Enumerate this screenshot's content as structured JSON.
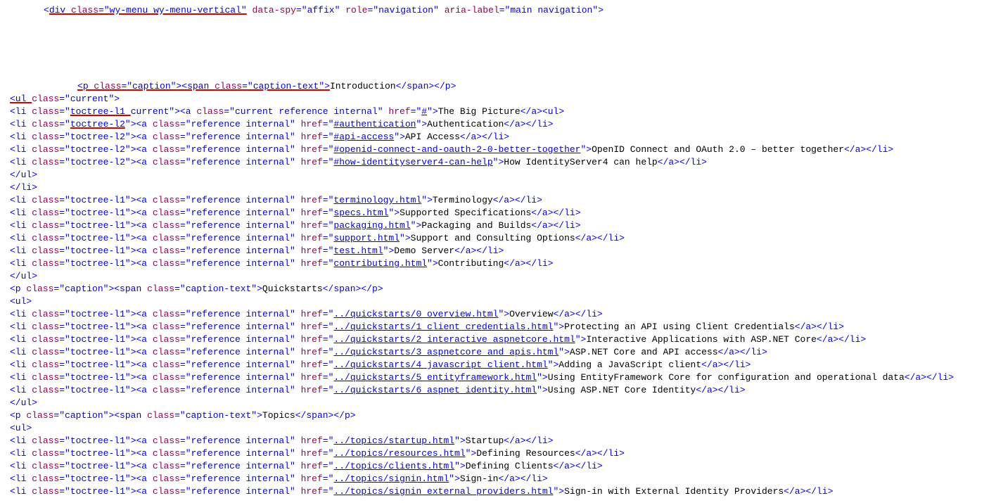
{
  "captions": {
    "intro": "Introduction",
    "quickstarts": "Quickstarts",
    "topics": "Topics"
  },
  "divAttrs": {
    "cls": "wy-menu wy-menu-vertical",
    "spy": "affix",
    "role": "navigation",
    "aria": "main navigation"
  },
  "introL1": [
    {
      "href": "#",
      "text": "The Big Picture",
      "current": true
    }
  ],
  "introL2": [
    {
      "href": "#authentication",
      "text": "Authentication"
    },
    {
      "href": "#api-access",
      "text": "API Access"
    },
    {
      "href": "#openid-connect-and-oauth-2-0-better-together",
      "text": "OpenID Connect and OAuth 2.0 – better together"
    },
    {
      "href": "#how-identityserver4-can-help",
      "text": "How IdentityServer4 can help"
    }
  ],
  "introL1more": [
    {
      "href": "terminology.html",
      "text": "Terminology"
    },
    {
      "href": "specs.html",
      "text": "Supported Specifications"
    },
    {
      "href": "packaging.html",
      "text": "Packaging and Builds"
    },
    {
      "href": "support.html",
      "text": "Support and Consulting Options"
    },
    {
      "href": "test.html",
      "text": "Demo Server"
    },
    {
      "href": "contributing.html",
      "text": "Contributing"
    }
  ],
  "quickstarts": [
    {
      "href": "../quickstarts/0_overview.html",
      "text": "Overview"
    },
    {
      "href": "../quickstarts/1_client_credentials.html",
      "text": "Protecting an API using Client Credentials"
    },
    {
      "href": "../quickstarts/2_interactive_aspnetcore.html",
      "text": "Interactive Applications with ASP.NET Core"
    },
    {
      "href": "../quickstarts/3_aspnetcore_and_apis.html",
      "text": "ASP.NET Core and API access"
    },
    {
      "href": "../quickstarts/4_javascript_client.html",
      "text": "Adding a JavaScript client"
    },
    {
      "href": "../quickstarts/5_entityframework.html",
      "text": "Using EntityFramework Core for configuration and operational data"
    },
    {
      "href": "../quickstarts/6_aspnet_identity.html",
      "text": "Using ASP.NET Core Identity"
    }
  ],
  "topics": [
    {
      "href": "../topics/startup.html",
      "text": "Startup"
    },
    {
      "href": "../topics/resources.html",
      "text": "Defining Resources"
    },
    {
      "href": "../topics/clients.html",
      "text": "Defining Clients"
    },
    {
      "href": "../topics/signin.html",
      "text": "Sign-in"
    },
    {
      "href": "../topics/signin_external_providers.html",
      "text": "Sign-in with External Identity Providers"
    }
  ],
  "tags": {
    "open": "<",
    "close": ">",
    "end": "</",
    "q": "\""
  }
}
